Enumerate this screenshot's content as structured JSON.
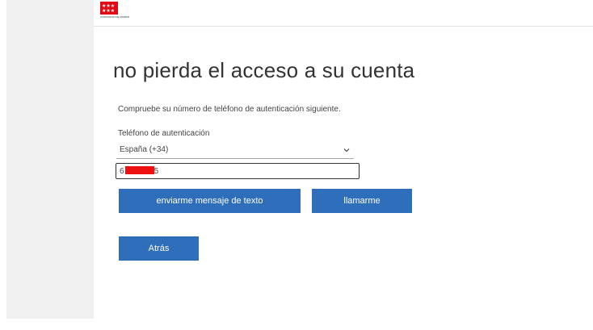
{
  "header": {
    "logo_text": "COMUNIDAD DE MADRID",
    "brand_color": "#e30613"
  },
  "main": {
    "title": "no pierda el acceso a su cuenta",
    "description": "Compruebe su número de teléfono de autenticación siguiente.",
    "phone_label": "Teléfono de autenticación",
    "country": {
      "selected": "España (+34)",
      "icon": "chevron-down-icon"
    },
    "phone": {
      "prefix": "6",
      "suffix": "5"
    },
    "buttons": {
      "sms": "enviarme mensaje de texto",
      "call": "llamarme",
      "back": "Atrás"
    },
    "accent_color": "#2f6eba"
  }
}
